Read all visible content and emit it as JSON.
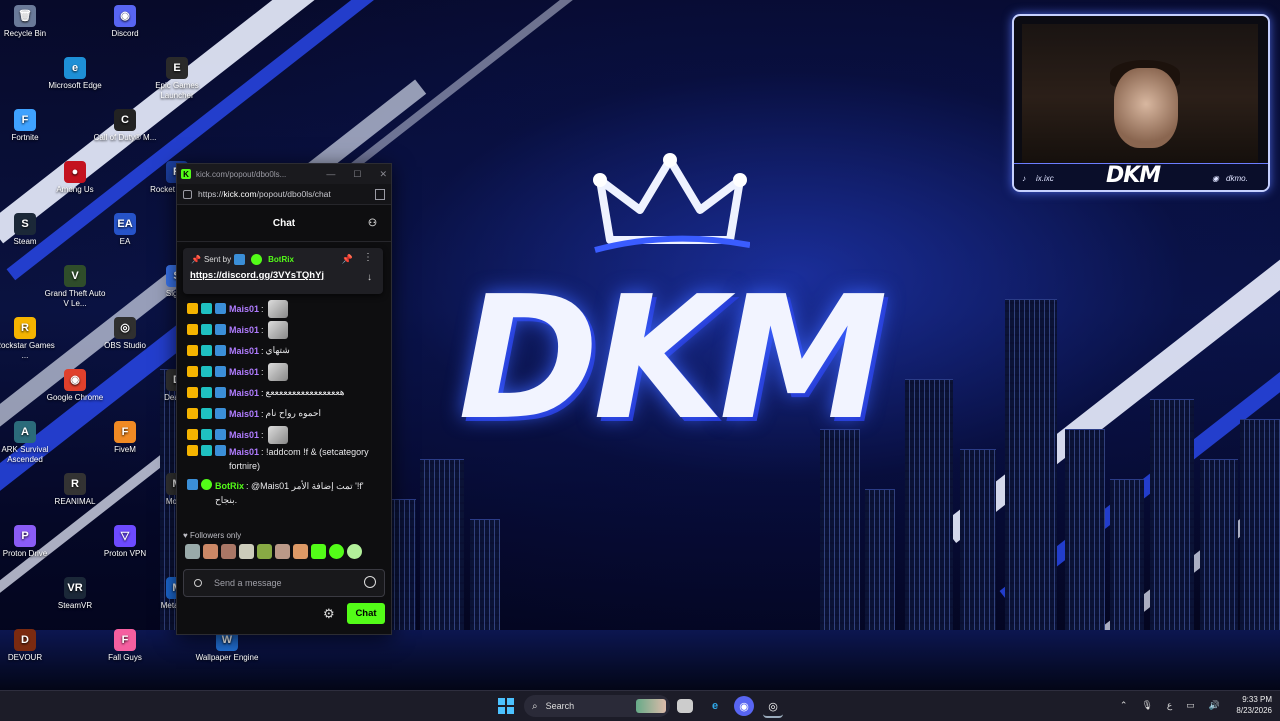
{
  "desktop": {
    "icons": [
      {
        "label": "Recycle Bin",
        "glyph": "🗑",
        "color": "#6a7a99"
      },
      {
        "label": "Discord",
        "glyph": "◉",
        "color": "#5865f2"
      },
      {
        "label": "Microsoft Edge",
        "glyph": "e",
        "color": "#1e90d6"
      },
      {
        "label": "Epic Games Launcher",
        "glyph": "E",
        "color": "#2a2a2a"
      },
      {
        "label": "Fortnite",
        "glyph": "F",
        "color": "#3fa2ff"
      },
      {
        "label": "Call of Duty® M...",
        "glyph": "C",
        "color": "#222"
      },
      {
        "label": "Among Us",
        "glyph": "●",
        "color": "#c4121f"
      },
      {
        "label": "Rocket League",
        "glyph": "R",
        "color": "#1b3fa0"
      },
      {
        "label": "Steam",
        "glyph": "S",
        "color": "#1b2838"
      },
      {
        "label": "EA",
        "glyph": "EA",
        "color": "#2653c8"
      },
      {
        "label": "Grand Theft Auto V Le...",
        "glyph": "V",
        "color": "#2f4d2a"
      },
      {
        "label": "Signal",
        "glyph": "S",
        "color": "#3a76f0"
      },
      {
        "label": "Rockstar Games ...",
        "glyph": "R",
        "color": "#f5b400"
      },
      {
        "label": "OBS Studio",
        "glyph": "◎",
        "color": "#303030"
      },
      {
        "label": "Google Chrome",
        "glyph": "◉",
        "color": "#e0402c"
      },
      {
        "label": "Dead...",
        "glyph": "D",
        "color": "#333"
      },
      {
        "label": "ARK Survival Ascended",
        "glyph": "A",
        "color": "#2b6b7a"
      },
      {
        "label": "FiveM",
        "glyph": "F",
        "color": "#f08a24"
      },
      {
        "label": "REANIMAL",
        "glyph": "R",
        "color": "#333"
      },
      {
        "label": "Mod...",
        "glyph": "M",
        "color": "#333"
      },
      {
        "label": "Proton Drive",
        "glyph": "P",
        "color": "#8a5cf5"
      },
      {
        "label": "Proton VPN",
        "glyph": "▽",
        "color": "#6d4aff"
      },
      {
        "label": "SteamVR",
        "glyph": "VR",
        "color": "#1b2838"
      },
      {
        "label": "Meta H...",
        "glyph": "M",
        "color": "#1c6bd6"
      },
      {
        "label": "DEVOUR",
        "glyph": "D",
        "color": "#7a2a10"
      },
      {
        "label": "Fall Guys",
        "glyph": "F",
        "color": "#f55fa0"
      },
      {
        "label": "Wallpaper Engine",
        "glyph": "W",
        "color": "#2170d6"
      }
    ],
    "logo_text": "DKM"
  },
  "webcam": {
    "brand": "DKM",
    "tiktok": "ix.ixc",
    "discord": "dkmo."
  },
  "browser": {
    "tab_title": "kick.com/popout/dbo0ls...",
    "url_prefix": "https://",
    "url_host": "kick.com",
    "url_path": "/popout/dbo0ls/chat",
    "min": "—",
    "max": "☐",
    "close": "✕"
  },
  "chat": {
    "header": "Chat",
    "pinned": {
      "sent_by_label": "Sent by",
      "sender": "BotRix",
      "link": "https://discord.gg/3VYsTQhYj"
    },
    "messages": [
      {
        "user": "Mais01",
        "text": "",
        "emote": true
      },
      {
        "user": "Mais01",
        "text": "",
        "emote": true
      },
      {
        "user": "Mais01",
        "text": "شتهاي",
        "emote": false
      },
      {
        "user": "Mais01",
        "text": "",
        "emote": true
      },
      {
        "user": "Mais01",
        "text": "هععععععععععععععععع",
        "emote": false
      },
      {
        "user": "Mais01",
        "text": "احموه رواح نام",
        "emote": false
      },
      {
        "user": "Mais01",
        "text": "",
        "emote": true
      }
    ],
    "command_msg": {
      "user": "Mais01",
      "text": "!addcom !f & (setcategory fortnire)"
    },
    "bot_msg": {
      "user": "BotRix",
      "text": "@Mais01 تمت إضافة الأمر '!f' بنجاح."
    },
    "followers_only": "Followers only",
    "input_placeholder": "Send a message",
    "send_label": "Chat"
  },
  "taskbar": {
    "search_label": "Search",
    "time": "9:33 PM",
    "date": "8/23/2026",
    "lang": "ع"
  },
  "colors": {
    "kick_green": "#53fc18",
    "username_purple": "#b07cff"
  }
}
